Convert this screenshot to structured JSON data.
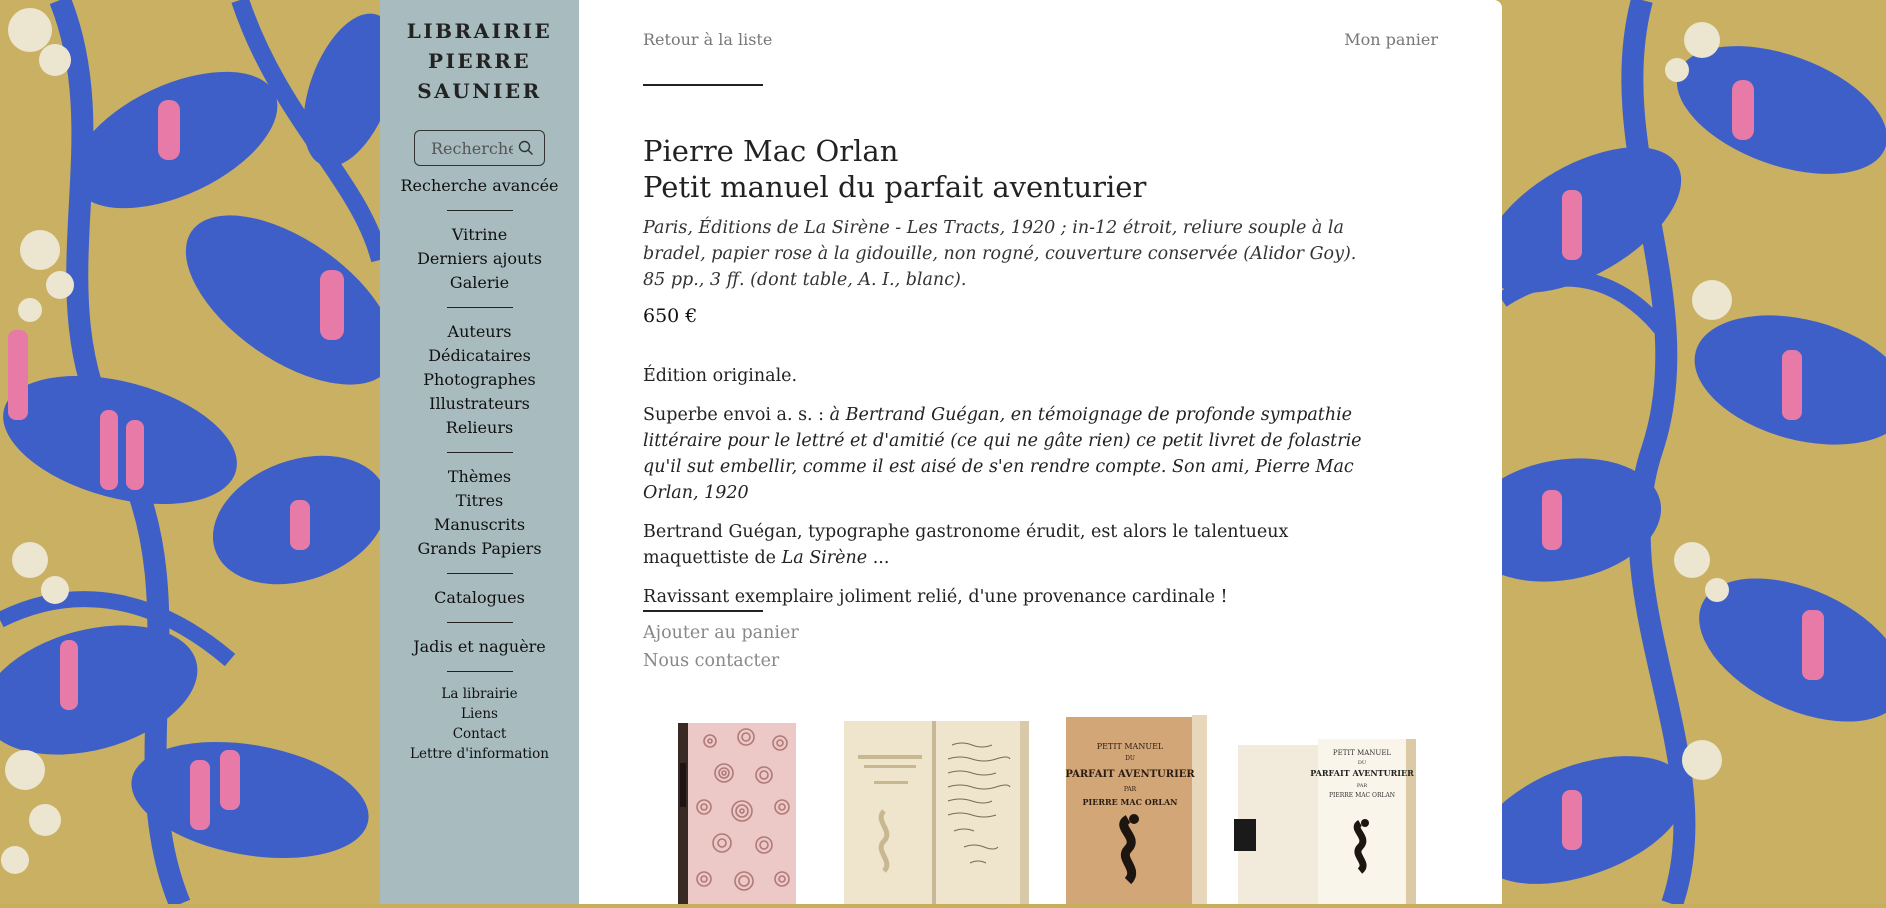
{
  "sidebar": {
    "logo_lines": [
      "LIBRAIRIE",
      "PIERRE",
      "SAUNIER"
    ],
    "search_placeholder": "Recherche",
    "advanced_search": "Recherche avancée",
    "group1": [
      "Vitrine",
      "Derniers ajouts",
      "Galerie"
    ],
    "group2": [
      "Auteurs",
      "Dédicataires",
      "Photographes",
      "Illustrateurs",
      "Relieurs"
    ],
    "group3": [
      "Thèmes",
      "Titres",
      "Manuscrits",
      "Grands Papiers"
    ],
    "group4": [
      "Catalogues"
    ],
    "group5": [
      "Jadis et naguère"
    ],
    "footer_links": [
      "La librairie",
      "Liens",
      "Contact",
      "Lettre d'information"
    ]
  },
  "nav": {
    "back": "Retour à la liste",
    "cart": "Mon panier"
  },
  "book": {
    "author": "Pierre Mac Orlan",
    "title": "Petit manuel du parfait aventurier",
    "description": "Paris, Éditions de La Sirène - Les Tracts, 1920 ; in-12 étroit, reliure souple à la bradel, papier rose à la gidouille, non rogné, couverture conservée (Alidor Goy). 85 pp., 3 ff. (dont table, A. I., blanc).",
    "price": "650 €",
    "p1": "Édition originale.",
    "p2_prefix": "Superbe envoi a. s. : ",
    "p2_italic": "à Bertrand Guégan, en témoignage de profonde sympathie littéraire pour le lettré et d'amitié (ce qui ne gâte rien) ce petit livret de folastrie qu'il sut embellir, comme il est aisé de s'en rendre compte. Son ami, Pierre Mac Orlan, 1920",
    "p3_prefix": "Bertrand Guégan, typographe gastronome érudit, est alors le talentueux maquettiste de ",
    "p3_italic": "La Sirène",
    "p3_suffix": " ...",
    "p4": "Ravissant exemplaire joliment relié, d'une provenance cardinale !"
  },
  "actions": {
    "add_to_cart": "Ajouter au panier",
    "contact": "Nous contacter"
  },
  "cover_text": {
    "line1": "PETIT MANUEL",
    "line2": "DU",
    "line3": "PARFAIT AVENTURIER",
    "line4": "PAR",
    "line5": "PIERRE MAC ORLAN"
  },
  "colors": {
    "sidebar_bg": "#a8bbbf",
    "pattern_ochre": "#c9b062",
    "pattern_blue": "#3f5fc8",
    "pattern_pink": "#e77aa6",
    "pattern_cream": "#ece5cf"
  }
}
